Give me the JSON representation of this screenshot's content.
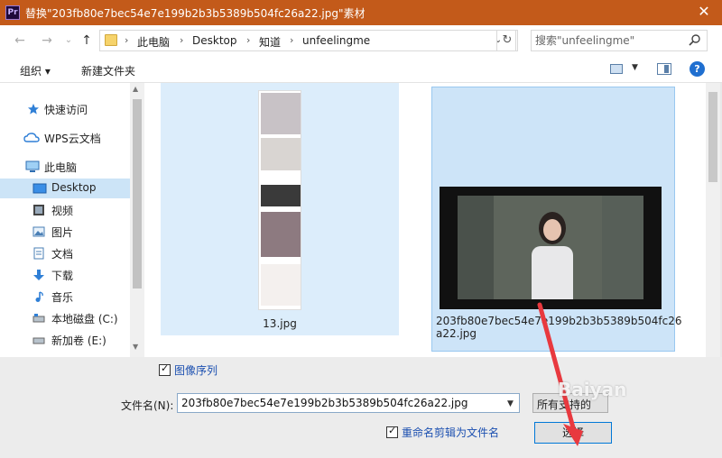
{
  "window": {
    "app_icon": "Pr",
    "title": "替换\"203fb80e7bec54e7e199b2b3b5389b504fc26a22.jpg\"素材",
    "close_glyph": "✕"
  },
  "address_bar": {
    "back_glyph": "←",
    "forward_glyph": "→",
    "caret_glyph": "⌄",
    "up_glyph": "↑",
    "sep_glyph": "›",
    "breadcrumbs": [
      "此电脑",
      "Desktop",
      "知道",
      "unfeelingme"
    ],
    "refresh_glyph": "↻",
    "search_placeholder": "搜索\"unfeelingme\""
  },
  "toolbar": {
    "organize_label": "组织 ▾",
    "new_folder_label": "新建文件夹",
    "help_glyph": "?",
    "view_caret": "▼"
  },
  "sidebar": {
    "items": [
      {
        "label": "快速访问",
        "icon": "star-icon"
      },
      {
        "label": "WPS云文档",
        "icon": "cloud-icon"
      },
      {
        "label": "此电脑",
        "icon": "computer-icon"
      },
      {
        "label": "Desktop",
        "icon": "desktop-icon",
        "selected": true
      },
      {
        "label": "视频",
        "icon": "video-icon"
      },
      {
        "label": "图片",
        "icon": "picture-icon"
      },
      {
        "label": "文档",
        "icon": "document-icon"
      },
      {
        "label": "下载",
        "icon": "download-icon"
      },
      {
        "label": "音乐",
        "icon": "music-icon"
      },
      {
        "label": "本地磁盘 (C:)",
        "icon": "drive-icon"
      },
      {
        "label": "新加卷 (E:)",
        "icon": "drive-icon"
      }
    ]
  },
  "files": [
    {
      "name": "13.jpg"
    },
    {
      "name": "203fb80e7bec54e7e199b2b3b5389b504fc26a22.jpg",
      "name_line1": "203fb80e7bec54e7e199b2b3b5389b504fc26",
      "name_line2": "a22.jpg",
      "selected": true
    }
  ],
  "bottom": {
    "image_sequence_label": "图像序列",
    "filename_label": "文件名(N):",
    "filename_value": "203fb80e7bec54e7e199b2b3b5389b504fc26a22.jpg",
    "filter_label": "所有支持的",
    "rename_label": "重命名剪辑为文件名",
    "open_label": "选择"
  },
  "annotation": {
    "watermark": "Baiyan",
    "arrow_color": "#e8393f"
  },
  "colors": {
    "titlebar": "#c35a1a",
    "selection": "#cce4f7",
    "link": "#1b4fb0"
  }
}
